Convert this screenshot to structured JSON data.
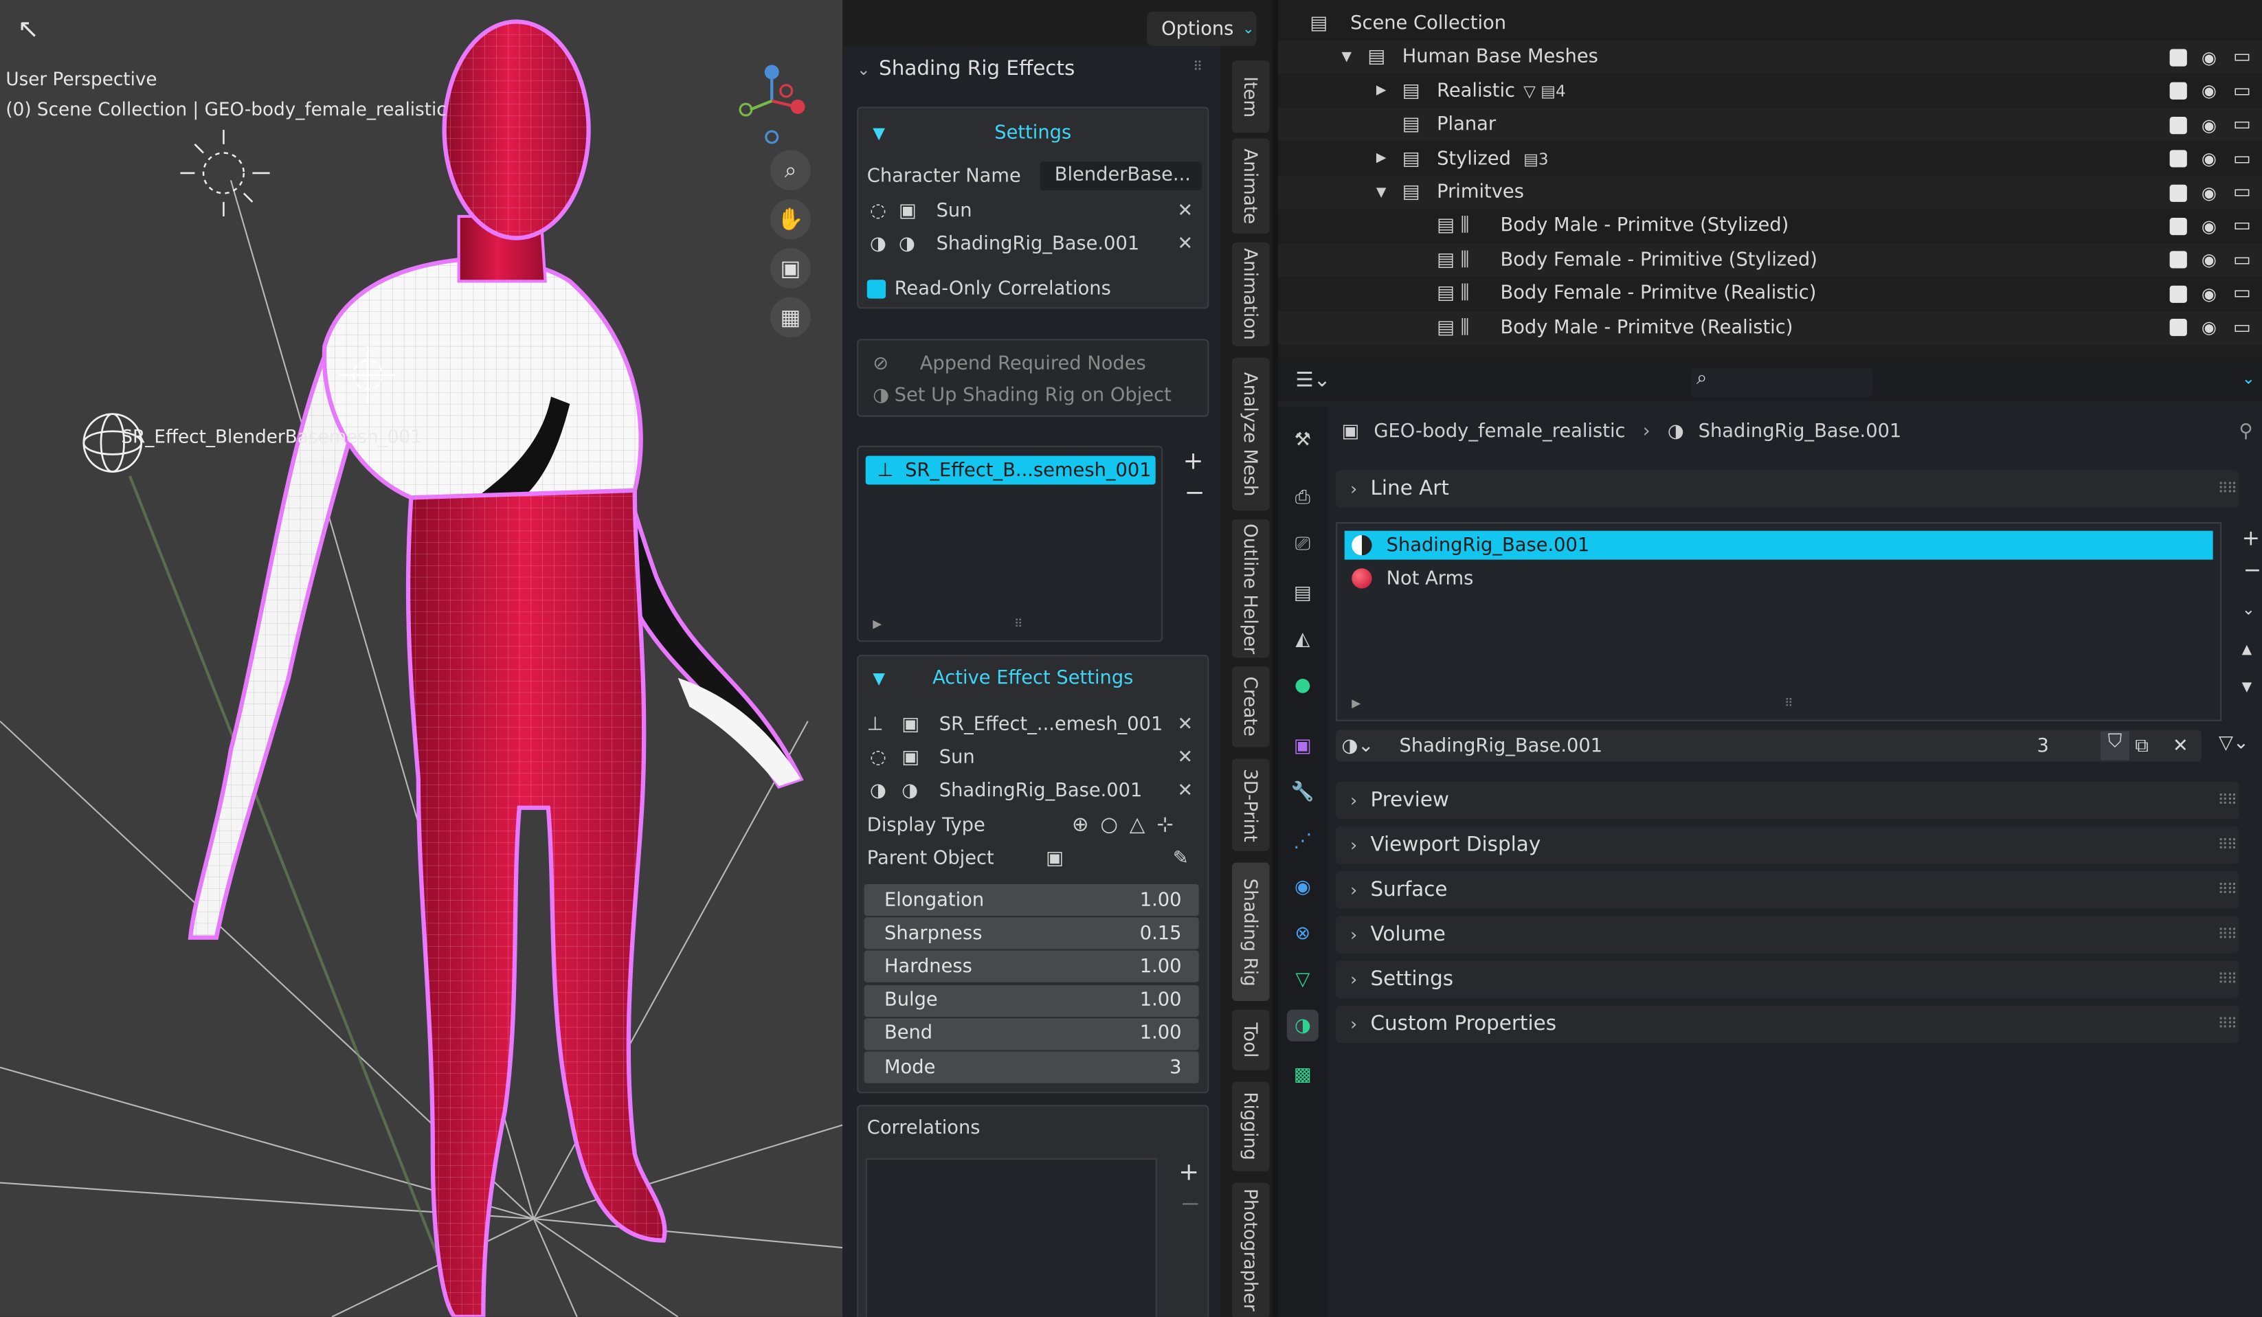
{
  "viewport": {
    "perspective_label": "User Perspective",
    "collection_label": "(0) Scene Collection | GEO-body_female_realistic",
    "effect_label": "SR_Effect_BlenderBasemesh_001",
    "options_label": "Options",
    "nav_icons": [
      "zoom-icon",
      "hand-pan-icon",
      "camera-icon",
      "grid-icon"
    ]
  },
  "shading_rig_panel": {
    "title": "Shading Rig Effects",
    "settings_header": "Settings",
    "character_name_label": "Character Name",
    "character_name_value": "BlenderBase...",
    "sun_label": "Sun",
    "material_label": "ShadingRig_Base.001",
    "read_only_label": "Read-Only Correlations",
    "append_nodes_label": "Append Required Nodes",
    "setup_rig_label": "Set Up Shading Rig on Object",
    "effect_list_item": "SR_Effect_B...semesh_001",
    "active_header": "Active Effect Settings",
    "active_effect_item": "SR_Effect_...emesh_001",
    "active_sun": "Sun",
    "active_material": "ShadingRig_Base.001",
    "display_type_label": "Display Type",
    "parent_object_label": "Parent Object",
    "params": [
      {
        "label": "Elongation",
        "value": "1.00"
      },
      {
        "label": "Sharpness",
        "value": "0.15"
      },
      {
        "label": "Hardness",
        "value": "1.00"
      },
      {
        "label": "Bulge",
        "value": "1.00"
      },
      {
        "label": "Bend",
        "value": "1.00"
      },
      {
        "label": "Mode",
        "value": "3"
      }
    ],
    "correlations_label": "Correlations"
  },
  "sidebar_tabs": [
    "Item",
    "Animate",
    "Animation",
    "Analyze Mesh",
    "Outline Helper",
    "Create",
    "3D-Print",
    "Shading Rig",
    "Tool",
    "Rigging",
    "Photographer"
  ],
  "outliner": {
    "rows": [
      {
        "label": "Scene Collection",
        "indent": 0
      },
      {
        "label": "Human Base Meshes",
        "indent": 1
      },
      {
        "label": "Realistic",
        "indent": 2,
        "badge": "4"
      },
      {
        "label": "Planar",
        "indent": 2
      },
      {
        "label": "Stylized",
        "indent": 2,
        "badge": "3"
      },
      {
        "label": "Primitves",
        "indent": 2
      },
      {
        "label": "Body Male - Primitve (Stylized)",
        "indent": 3
      },
      {
        "label": "Body Female - Primitive (Stylized)",
        "indent": 3
      },
      {
        "label": "Body Female - Primitve (Realistic)",
        "indent": 3
      },
      {
        "label": "Body Male - Primitve (Realistic)",
        "indent": 3
      }
    ]
  },
  "properties": {
    "breadcrumb_object": "GEO-body_female_realistic",
    "breadcrumb_material": "ShadingRig_Base.001",
    "line_art_label": "Line Art",
    "material_slots": [
      {
        "label": "ShadingRig_Base.001",
        "selected": true
      },
      {
        "label": "Not Arms",
        "selected": false
      }
    ],
    "material_name": "ShadingRig_Base.001",
    "user_count": "3",
    "sections": [
      "Preview",
      "Viewport Display",
      "Surface",
      "Volume",
      "Settings",
      "Custom Properties"
    ]
  },
  "colors": {
    "accent": "#13c6ef",
    "mesh_red": "#d11640",
    "outline": "#e879ff"
  }
}
